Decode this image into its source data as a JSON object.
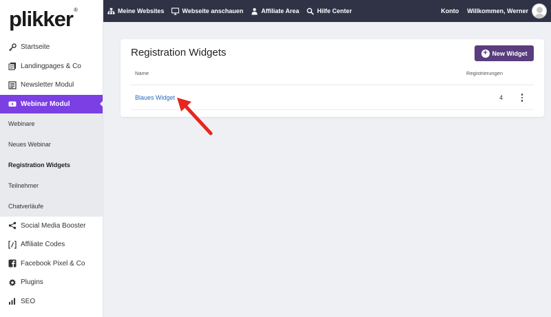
{
  "logo": {
    "text": "plikker",
    "registered": "®"
  },
  "sidebar": {
    "items": [
      {
        "label": "Startseite",
        "icon": "key-icon"
      },
      {
        "label": "Landingpages & Co",
        "icon": "pages-icon"
      },
      {
        "label": "Newsletter Modul",
        "icon": "newsletter-icon"
      },
      {
        "label": "Webinar Modul",
        "icon": "youtube-icon"
      },
      {
        "label": "Social Media Booster",
        "icon": "share-icon"
      },
      {
        "label": "Affiliate Codes",
        "icon": "code-bracket-icon"
      },
      {
        "label": "Facebook Pixel & Co",
        "icon": "facebook-icon"
      },
      {
        "label": "Plugins",
        "icon": "gear-icon"
      },
      {
        "label": "SEO",
        "icon": "bar-chart-icon"
      }
    ],
    "submenu": [
      {
        "label": "Webinare"
      },
      {
        "label": "Neues Webinar"
      },
      {
        "label": "Registration Widgets"
      },
      {
        "label": "Teilnehmer"
      },
      {
        "label": "Chatverläufe"
      }
    ]
  },
  "topbar": {
    "links": [
      {
        "label": "Meine Websites",
        "icon": "sitemap-icon"
      },
      {
        "label": "Webseite anschauen",
        "icon": "monitor-icon"
      },
      {
        "label": "Affiliate Area",
        "icon": "user-icon"
      },
      {
        "label": "Hilfe Center",
        "icon": "search-icon"
      }
    ],
    "konto": "Konto",
    "welcome": "Willkommen, Werner"
  },
  "card": {
    "title": "Registration Widgets",
    "new_button": "New Widget",
    "columns": {
      "name": "Name",
      "registrations": "Registrierungen"
    },
    "rows": [
      {
        "name": "Blaues Widget",
        "count": "4"
      }
    ]
  },
  "colors": {
    "sidebar_active": "#7b3fe4",
    "topbar": "#303346",
    "button": "#5a3d7d",
    "link": "#2a6db8",
    "arrow": "#e8251f"
  }
}
